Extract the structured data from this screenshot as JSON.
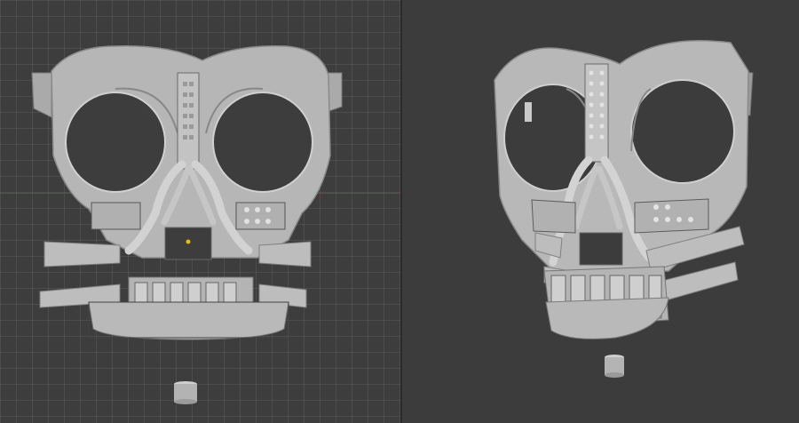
{
  "viewports": [
    {
      "id": "left",
      "mode": "orthographic-front",
      "grid": true,
      "x_axis_color": "#8a3c43"
    },
    {
      "id": "right",
      "mode": "perspective",
      "grid": false
    }
  ],
  "model": {
    "name": "skull-mask",
    "color": "#b5b5b5",
    "shadow": "#8e8e8e",
    "highlight": "#cfcfcf"
  }
}
